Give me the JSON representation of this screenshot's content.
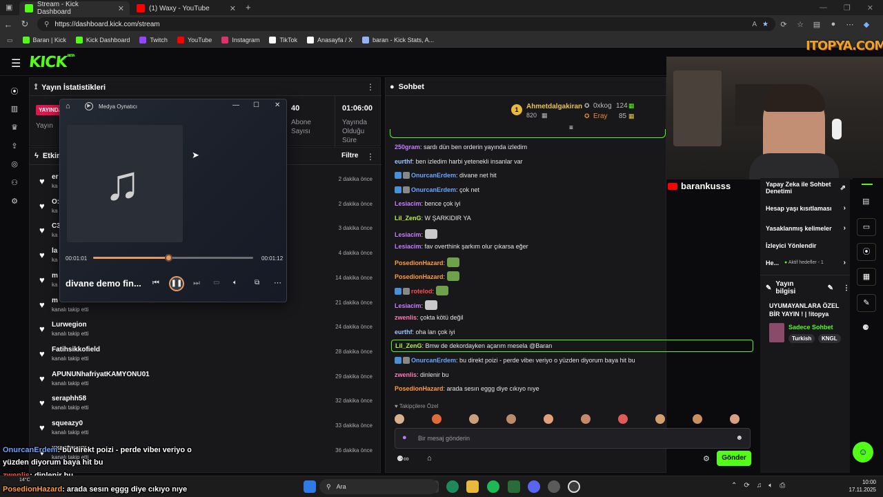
{
  "browser": {
    "tabs": [
      {
        "title": "Stream - Kick Dashboard",
        "icon": "kick-icon",
        "color": "#53fc18"
      },
      {
        "title": "(1) Waxy - YouTube",
        "icon": "youtube-icon",
        "color": "#ff0000"
      }
    ],
    "url": "https://dashboard.kick.com/stream",
    "bookmarks": [
      {
        "label": "Baran | Kick",
        "icon": "kick-icon",
        "color": "#53fc18"
      },
      {
        "label": "Kick Dashboard",
        "icon": "kick-icon",
        "color": "#53fc18"
      },
      {
        "label": "Twitch",
        "icon": "twitch-icon",
        "color": "#9146ff"
      },
      {
        "label": "YouTube",
        "icon": "youtube-icon",
        "color": "#ff0000"
      },
      {
        "label": "Instagram",
        "icon": "instagram-icon",
        "color": "#e1306c"
      },
      {
        "label": "TikTok",
        "icon": "tiktok-icon",
        "color": "#ffffff"
      },
      {
        "label": "Anasayfa / X",
        "icon": "x-icon",
        "color": "#ffffff"
      },
      {
        "label": "baran - Kick Stats, A...",
        "icon": "stats-icon",
        "color": "#8fb3ff"
      }
    ]
  },
  "stats": {
    "title": "Yayın İstatistikleri",
    "live_badge": "YAYINDA",
    "col1_label": "Yayın",
    "subs_value": "40",
    "subs_label_1": "Abone",
    "subs_label_2": "Sayısı",
    "time_value": "01:06:00",
    "time_label_1": "Yayında",
    "time_label_2": "Olduğu",
    "time_label_3": "Süre"
  },
  "events": {
    "title": "Etkin",
    "filter_label": "Filtre",
    "items": [
      {
        "name": "er",
        "sub": "ka",
        "time": "2 dakika önce"
      },
      {
        "name": "O:",
        "sub": "ka",
        "time": "2 dakika önce"
      },
      {
        "name": "C3",
        "sub": "ka",
        "time": "3 dakika önce"
      },
      {
        "name": "la",
        "sub": "ka",
        "time": "4 dakika önce"
      },
      {
        "name": "m",
        "sub": "ka",
        "time": "14 dakika önce"
      },
      {
        "name": "m",
        "sub": "kanalı takip etti",
        "time": "21 dakika önce"
      },
      {
        "name": "Lurwegion",
        "sub": "kanalı takip etti",
        "time": "24 dakika önce"
      },
      {
        "name": "Fatihsikkofield",
        "sub": "kanalı takip etti",
        "time": "28 dakika önce"
      },
      {
        "name": "APUNUNhafriyatKAMYONU01",
        "sub": "kanalı takip etti",
        "time": "29 dakika önce"
      },
      {
        "name": "seraphh58",
        "sub": "kanalı takip etti",
        "time": "32 dakika önce"
      },
      {
        "name": "squeazy0",
        "sub": "kanalı takip etti",
        "time": "33 dakika önce"
      },
      {
        "name": "xxastwoxx",
        "sub": "kanalı takip etti",
        "time": "36 dakika önce"
      }
    ]
  },
  "media": {
    "title": "Medya Oynatıcı",
    "track": "divane demo fin...",
    "elapsed": "00:01:01",
    "total": "00:01:12",
    "progress": 0.47
  },
  "chat": {
    "title": "Sohbet",
    "leaders": [
      {
        "rank": "1",
        "name": "Ahmetdalgakiran",
        "value": "820"
      },
      {
        "name": "0xkog",
        "value": "124"
      },
      {
        "name": "Eray",
        "value": "85"
      }
    ],
    "messages": [
      {
        "user": "250gram",
        "color": "#c77dff",
        "text": ": sardı dün ben orderin yayında izledim"
      },
      {
        "user": "eurthf",
        "color": "#9ec5ff",
        "text": ": ben izledim harbi yetenekli insanlar var"
      },
      {
        "user": "OnurcanErdem",
        "color": "#6aa6ff",
        "text": ": divane net hit",
        "badges": 2
      },
      {
        "user": "OnurcanErdem",
        "color": "#6aa6ff",
        "text": ": çok net",
        "badges": 2
      },
      {
        "user": "Lesiacim",
        "color": "#c77dff",
        "text": ": bence çok iyi"
      },
      {
        "user": "Lil_ZenG",
        "color": "#b6f24a",
        "text": ": W ŞARKIDIR YA"
      },
      {
        "user": "Lesiacim",
        "color": "#c77dff",
        "text": ": ",
        "emote": "#c9c9c9"
      },
      {
        "user": "Lesiacim",
        "color": "#c77dff",
        "text": ": fav overthink şarkım olur çıkarsa eğer"
      },
      {
        "user": "PosedionHazard",
        "color": "#ff9d3b",
        "text": ": ",
        "emote": "#6fa04b"
      },
      {
        "user": "PosedionHazard",
        "color": "#ff9d3b",
        "text": ": ",
        "emote": "#6fa04b"
      },
      {
        "user": "rotelod",
        "color": "#ff4a4a",
        "text": ": ",
        "emote": "#6fa04b",
        "badges": 2
      },
      {
        "user": "Lesiacim",
        "color": "#c77dff",
        "text": ": ",
        "emote": "#c9c9c9"
      },
      {
        "user": "zwenlis",
        "color": "#ff7ab8",
        "text": ": çokta kötü değil"
      },
      {
        "user": "eurthf",
        "color": "#9ec5ff",
        "text": ": oha lan çok iyi"
      },
      {
        "user": "Lil_ZenG",
        "color": "#b6f24a",
        "text": ": Bmw de dekordayken açarım mesela @Baran",
        "highlight": true
      },
      {
        "user": "OnurcanErdem",
        "color": "#6aa6ff",
        "text": ": bu direkt poizi - perde vibeı veriyo o yüzden diyorum baya hit bu",
        "badges": 2
      },
      {
        "user": "zwenlis",
        "color": "#ff7ab8",
        "text": ": dinlenir bu"
      },
      {
        "user": "PosedionHazard",
        "color": "#ff9d3b",
        "text": ": arada sesın eggg diye cıkıyo nıye"
      }
    ],
    "followers_only": "Takipçilere Özel",
    "input_placeholder": "Bir mesaj gönderin",
    "send_label": "Gönder"
  },
  "right_panel": {
    "item0": "Yapay Zeka ile Sohbet Denetimi",
    "item1": "Hesap yaşı kısıtlaması",
    "item2": "Yasaklanmış kelimeler",
    "item3": "İzleyici Yönlendir",
    "item4": "He...",
    "item4_status": "Aktif hedefler - 1",
    "info_title": "Yayın bilgisi",
    "stream_title": "UYUMAYANLARA ÖZEL BİR YAYIN ! | !itopya",
    "category": "Sadece Sohbet",
    "tags": [
      "Turkish",
      "KNGL"
    ]
  },
  "overlay": {
    "sponsor": "ITOPYA.COM",
    "channel": "barankusss",
    "chat1_user": "OnurcanErdem",
    "chat1_text": ": bu direkt poizi - perde vibeı veriyo o",
    "chat1_text2": "yüzden diyorum baya hit bu",
    "chat2_user": "zwenlis",
    "chat2_text": ": dinlenir bu",
    "chat3_user": "PosedionHazard",
    "chat3_text": ": arada sesın eggg diye cıkıyo nıye",
    "weather": "14°C"
  },
  "taskbar": {
    "search_label": "Ara",
    "time": "10:00",
    "date": "17.11.2025"
  }
}
